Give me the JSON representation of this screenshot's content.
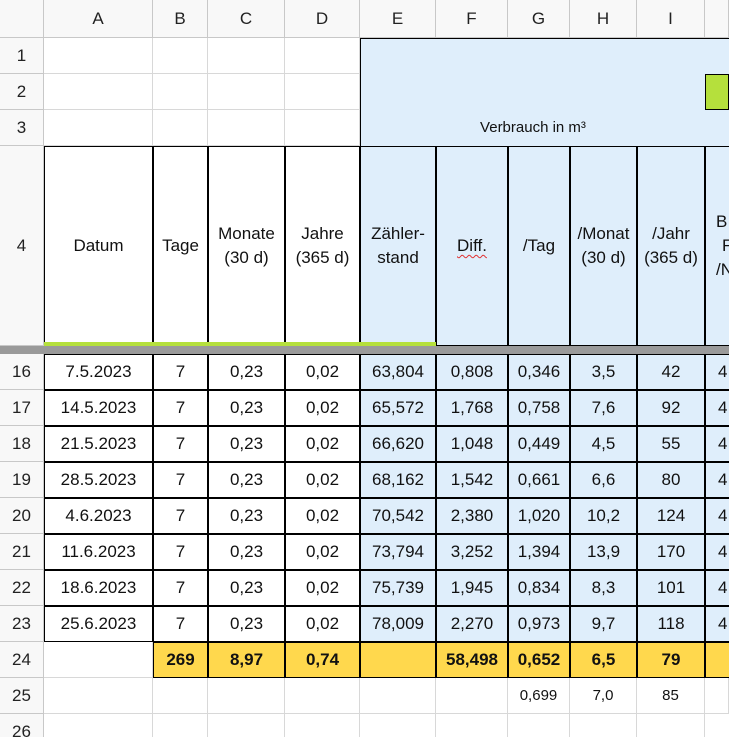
{
  "columns": [
    "A",
    "B",
    "C",
    "D",
    "E",
    "F",
    "G",
    "H",
    "I"
  ],
  "row_numbers": {
    "r1": "1",
    "r2": "2",
    "r3": "3",
    "r4": "4",
    "r16": "16",
    "r17": "17",
    "r18": "18",
    "r19": "19",
    "r20": "20",
    "r21": "21",
    "r22": "22",
    "r23": "23",
    "r24": "24",
    "r25": "25",
    "r26": "26"
  },
  "merged_title": "Verbrauch in m³",
  "headers": {
    "datum": "Datum",
    "tage": "Tage",
    "monate_1": "Monate",
    "monate_2": "(30 d)",
    "jahre_1": "Jahre",
    "jahre_2": "(365 d)",
    "zaehler_1": "Zähler-",
    "zaehler_2": "stand",
    "diff": "Diff.",
    "tag": "/Tag",
    "monat_1": "/Monat",
    "monat_2": "(30 d)",
    "jahr_1": "/Jahr",
    "jahr_2": "(365 d)",
    "j_1": "B",
    "j_2": "F",
    "j_3": "/N"
  },
  "rows": [
    {
      "datum": "7.5.2023",
      "tage": "7",
      "monate": "0,23",
      "jahre": "0,02",
      "zaehler": "63,804",
      "diff": "0,808",
      "tag": "0,346",
      "monat": "3,5",
      "jahr": "42",
      "j": "4"
    },
    {
      "datum": "14.5.2023",
      "tage": "7",
      "monate": "0,23",
      "jahre": "0,02",
      "zaehler": "65,572",
      "diff": "1,768",
      "tag": "0,758",
      "monat": "7,6",
      "jahr": "92",
      "j": "4"
    },
    {
      "datum": "21.5.2023",
      "tage": "7",
      "monate": "0,23",
      "jahre": "0,02",
      "zaehler": "66,620",
      "diff": "1,048",
      "tag": "0,449",
      "monat": "4,5",
      "jahr": "55",
      "j": "4"
    },
    {
      "datum": "28.5.2023",
      "tage": "7",
      "monate": "0,23",
      "jahre": "0,02",
      "zaehler": "68,162",
      "diff": "1,542",
      "tag": "0,661",
      "monat": "6,6",
      "jahr": "80",
      "j": "4"
    },
    {
      "datum": "4.6.2023",
      "tage": "7",
      "monate": "0,23",
      "jahre": "0,02",
      "zaehler": "70,542",
      "diff": "2,380",
      "tag": "1,020",
      "monat": "10,2",
      "jahr": "124",
      "j": "4"
    },
    {
      "datum": "11.6.2023",
      "tage": "7",
      "monate": "0,23",
      "jahre": "0,02",
      "zaehler": "73,794",
      "diff": "3,252",
      "tag": "1,394",
      "monat": "13,9",
      "jahr": "170",
      "j": "4"
    },
    {
      "datum": "18.6.2023",
      "tage": "7",
      "monate": "0,23",
      "jahre": "0,02",
      "zaehler": "75,739",
      "diff": "1,945",
      "tag": "0,834",
      "monat": "8,3",
      "jahr": "101",
      "j": "4"
    },
    {
      "datum": "25.6.2023",
      "tage": "7",
      "monate": "0,23",
      "jahre": "0,02",
      "zaehler": "78,009",
      "diff": "2,270",
      "tag": "0,973",
      "monat": "9,7",
      "jahr": "118",
      "j": "4"
    }
  ],
  "totals": {
    "tage": "269",
    "monate": "8,97",
    "jahre": "0,74",
    "diff": "58,498",
    "tag": "0,652",
    "monat": "6,5",
    "jahr": "79"
  },
  "row25": {
    "tag": "0,699",
    "monat": "7,0",
    "jahr": "85"
  },
  "colors": {
    "blue_fill": "#dfeefb",
    "green_fill": "#b5e03c",
    "yellow_fill": "#ffd84d",
    "freeze_line": "#9a9a9a"
  }
}
